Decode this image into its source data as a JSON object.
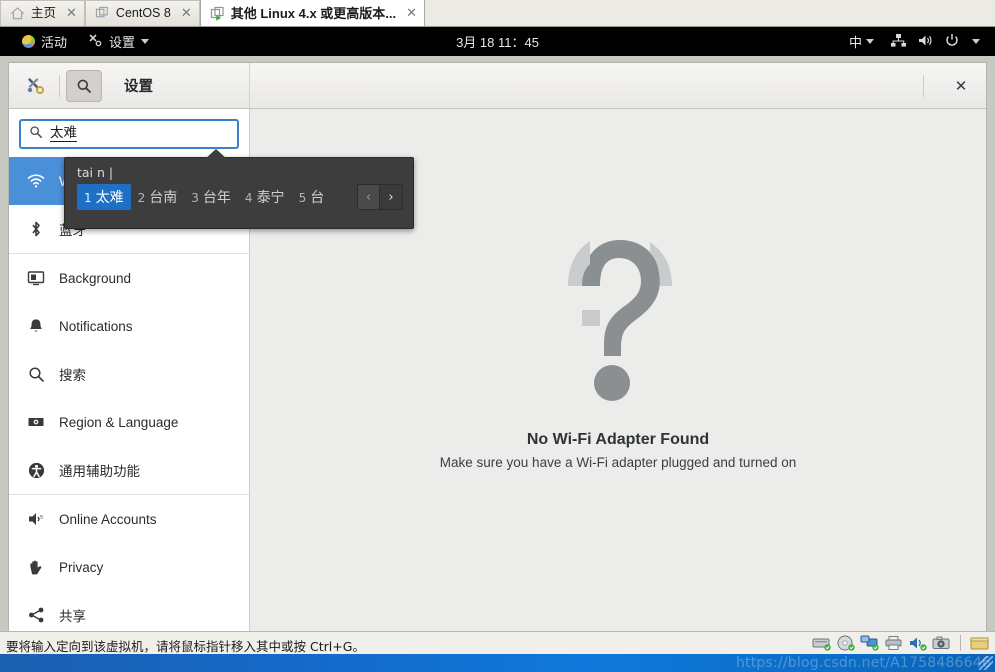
{
  "vmware": {
    "tabs": [
      {
        "label": "主页",
        "icon": "home-icon",
        "active": false,
        "closable": true
      },
      {
        "label": "CentOS 8",
        "icon": "vm-icon",
        "active": false,
        "closable": true
      },
      {
        "label": "其他 Linux 4.x 或更高版本...",
        "icon": "vm-running-icon",
        "active": true,
        "closable": true
      }
    ],
    "status_message": "要将输入定向到该虚拟机，请将鼠标指针移入其中或按 Ctrl+G。",
    "tray_icons": [
      "hard-disk-icon",
      "cd-dvd-icon",
      "network-adapter-icon",
      "printer-icon",
      "sound-card-icon",
      "camera-icon",
      "usb-folder-icon"
    ],
    "watermark": "https://blog.csdn.net/A1758486646"
  },
  "gnome_topbar": {
    "activities_label": "活动",
    "app_menu_label": "设置",
    "clock": "3月 18  11：45",
    "ime_indicator": "中",
    "status_icons": [
      "network-wired-icon",
      "volume-icon",
      "power-icon",
      "chevron-down-icon"
    ]
  },
  "settings_window": {
    "title": "设置",
    "header_icons": [
      "settings-tools-icon",
      "search-toggle-icon"
    ],
    "close_label": "✕",
    "search": {
      "value": "太难",
      "placeholder": "",
      "icon": "search-icon"
    },
    "sidebar_items": [
      {
        "label": "Wi-Fi",
        "icon": "wifi-icon",
        "selected": true,
        "separator_after": false
      },
      {
        "label": "蓝牙",
        "icon": "bluetooth-icon",
        "selected": false,
        "separator_after": true
      },
      {
        "label": "Background",
        "icon": "background-icon",
        "selected": false,
        "separator_after": false
      },
      {
        "label": "Notifications",
        "icon": "bell-icon",
        "selected": false,
        "separator_after": false
      },
      {
        "label": "搜索",
        "icon": "search-icon",
        "selected": false,
        "separator_after": false
      },
      {
        "label": "Region & Language",
        "icon": "region-language-icon",
        "selected": false,
        "separator_after": false
      },
      {
        "label": "通用辅助功能",
        "icon": "accessibility-icon",
        "selected": false,
        "separator_after": true
      },
      {
        "label": "Online Accounts",
        "icon": "online-accounts-icon",
        "selected": false,
        "separator_after": false
      },
      {
        "label": "Privacy",
        "icon": "privacy-hand-icon",
        "selected": false,
        "separator_after": false
      },
      {
        "label": "共享",
        "icon": "sharing-icon",
        "selected": false,
        "separator_after": false
      }
    ],
    "main": {
      "illustration": "question-mark-icon",
      "title": "No Wi-Fi Adapter Found",
      "subtitle": "Make sure you have a Wi-Fi adapter plugged and turned on"
    }
  },
  "ime_popup": {
    "preedit": "tai n |",
    "candidates": [
      {
        "index": "1",
        "text": "太难",
        "selected": true
      },
      {
        "index": "2",
        "text": "台南",
        "selected": false
      },
      {
        "index": "3",
        "text": "台年",
        "selected": false
      },
      {
        "index": "4",
        "text": "泰宁",
        "selected": false
      },
      {
        "index": "5",
        "text": "台",
        "selected": false
      }
    ],
    "prev_label": "‹",
    "next_label": "›"
  },
  "colors": {
    "selection_blue": "#4a90d9",
    "ime_selection_blue": "#1f6fc4",
    "ime_bg": "#3d3d3d",
    "panel_bg": "#ececea",
    "topbar_bg": "#000000"
  }
}
